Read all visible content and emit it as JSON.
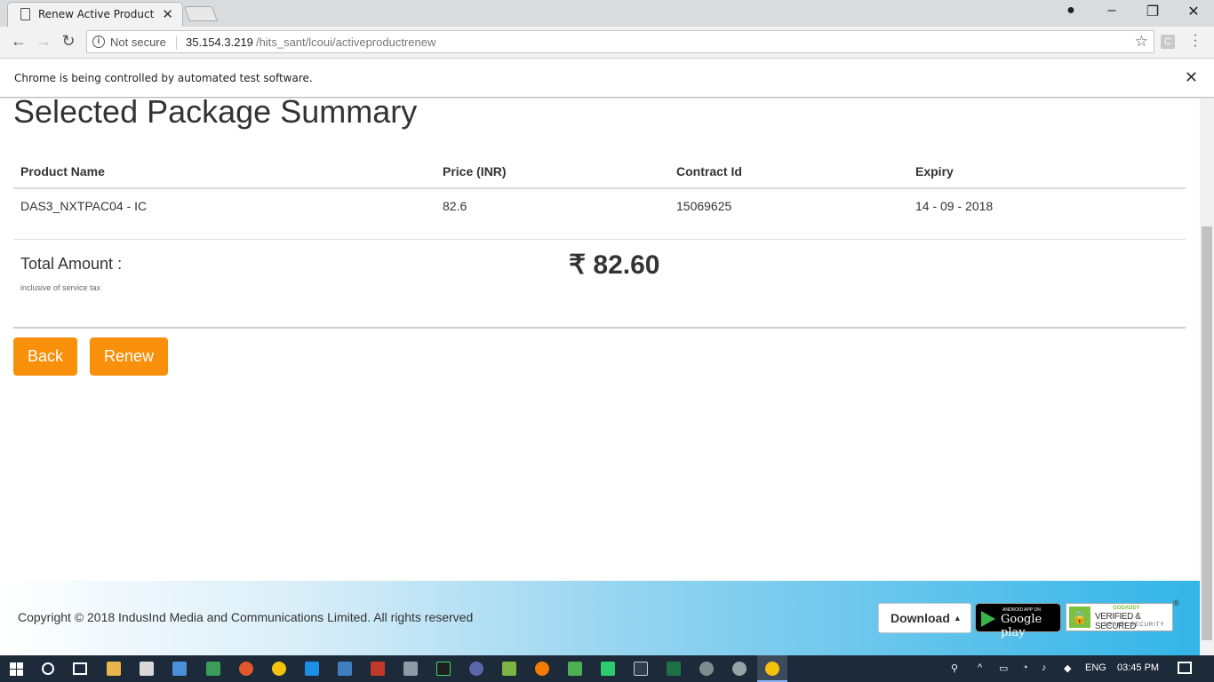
{
  "browser": {
    "tab_title": "Renew Active Product",
    "address": {
      "security_label": "Not secure",
      "host": "35.154.3.219",
      "path": "/hits_sant/lcoui/activeproductrenew"
    },
    "extension_label": "C",
    "infobar_message": "Chrome is being controlled by automated test software."
  },
  "page": {
    "heading": "Selected Package Summary",
    "table": {
      "headers": [
        "Product Name",
        "Price (INR)",
        "Contract Id",
        "Expiry"
      ],
      "rows": [
        [
          "DAS3_NXTPAC04 - IC",
          "82.6",
          "15069625",
          "14 - 09 - 2018"
        ]
      ]
    },
    "total": {
      "label": "Total Amount :",
      "note": "inclusive of service tax",
      "amount": "₹ 82.60"
    },
    "buttons": {
      "back": "Back",
      "renew": "Renew"
    }
  },
  "footer": {
    "copyright": "Copyright © 2018 IndusInd Media and Communications Limited. All rights reserved",
    "download_label": "Download",
    "google_play_small": "ANDROID APP ON",
    "google_play_big": "Google play",
    "godaddy_brand": "GODADDY",
    "godaddy_title": "VERIFIED & SECURED",
    "godaddy_sub": "VERIFY SECURITY",
    "registered_mark": "®"
  },
  "taskbar": {
    "language": "ENG",
    "time": "03:45 PM"
  },
  "colors": {
    "accent_orange": "#f8900b",
    "footer_blue": "#33b5e8",
    "taskbar": "#1c2a3a"
  }
}
